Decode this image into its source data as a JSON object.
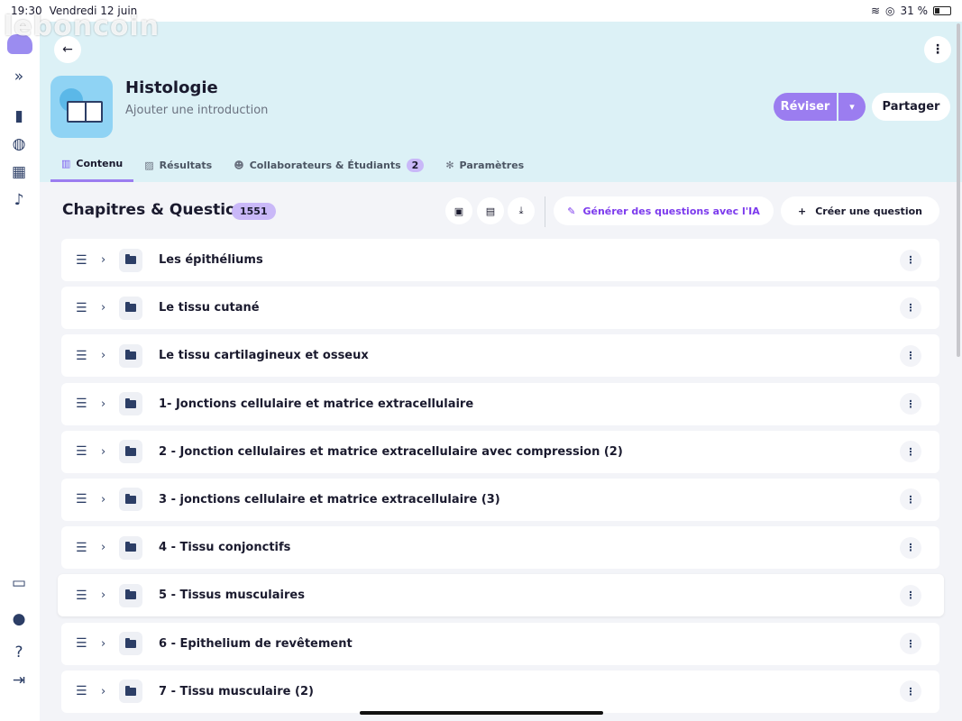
{
  "status_bar": {
    "time": "19:30",
    "date": "Vendredi 12 juin",
    "battery": "31 %"
  },
  "watermark": "leboncoin",
  "sidebar": {
    "top": [
      "expand-icon",
      "book-icon",
      "globe-icon",
      "calendar-icon",
      "bell-icon"
    ],
    "bottom": [
      "language-icon",
      "user-icon",
      "help-icon",
      "logout-icon"
    ]
  },
  "header": {
    "title": "Histologie",
    "intro": "Ajouter une introduction",
    "reviser_label": "Réviser",
    "share_label": "Partager"
  },
  "tabs": [
    {
      "label": "Contenu",
      "icon": "library-icon",
      "active": true
    },
    {
      "label": "Résultats",
      "icon": "chart-icon",
      "active": false
    },
    {
      "label": "Collaborateurs & Étudiants",
      "icon": "users-icon",
      "count": "2",
      "active": false
    },
    {
      "label": "Paramètres",
      "icon": "gear-icon",
      "active": false
    }
  ],
  "toolbar": {
    "title": "Chapitres & Questions",
    "count": "1551",
    "generate_label": "Générer des questions avec l'IA",
    "create_label": "Créer une question"
  },
  "chapters": [
    "Les épithéliums",
    "Le tissu cutané",
    "Le tissu cartilagineux et osseux",
    "1- Jonctions cellulaire et matrice extracellulaire",
    "2 - Jonction cellulaires et matrice extracellulaire avec compression (2)",
    "3 - jonctions cellulaire et matrice extracellulaire (3)",
    "4 - Tissu conjonctifs",
    "5 - Tissus musculaires",
    "6 - Epithelium de revêtement",
    "7 - Tissu musculaire (2)"
  ],
  "colors": {
    "accent": "#9b7df0",
    "header_bg": "#dcf1f6",
    "badge": "#c9b8f8"
  }
}
